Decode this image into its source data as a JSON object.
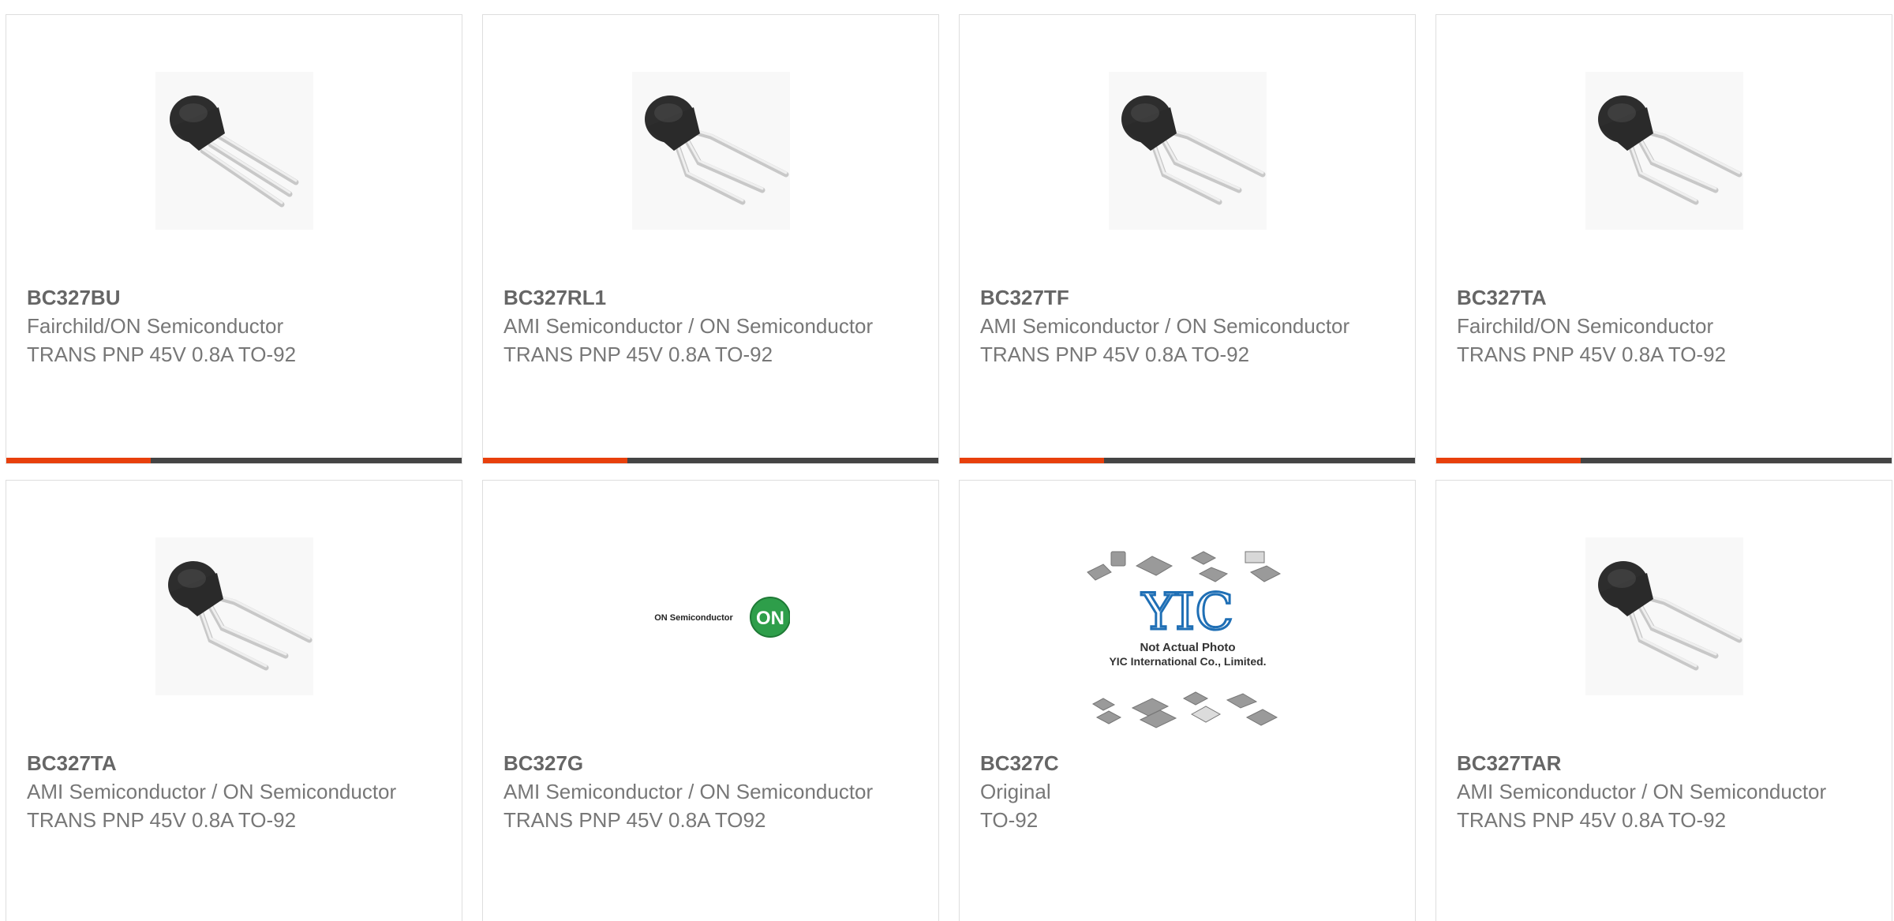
{
  "colors": {
    "accent": "#e8400c",
    "bar": "#444444",
    "on_logo_green": "#2e9e4a",
    "yic_blue": "#1f6fb5"
  },
  "products": [
    {
      "part": "BC327BU",
      "manufacturer": "Fairchild/ON Semiconductor",
      "description": "TRANS PNP 45V 0.8A TO-92",
      "image_icon": "to92-transistor-icon"
    },
    {
      "part": "BC327RL1",
      "manufacturer": "AMI Semiconductor / ON Semiconductor",
      "description": "TRANS PNP 45V 0.8A TO-92",
      "image_icon": "to92-transistor-bent-leads-icon"
    },
    {
      "part": "BC327TF",
      "manufacturer": "AMI Semiconductor / ON Semiconductor",
      "description": "TRANS PNP 45V 0.8A TO-92",
      "image_icon": "to92-transistor-bent-leads-icon"
    },
    {
      "part": "BC327TA",
      "manufacturer": "Fairchild/ON Semiconductor",
      "description": "TRANS PNP 45V 0.8A TO-92",
      "image_icon": "to92-transistor-bent-leads-icon"
    },
    {
      "part": "BC327TA",
      "manufacturer": "AMI Semiconductor / ON Semiconductor",
      "description": "TRANS PNP 45V 0.8A TO-92",
      "image_icon": "to92-transistor-bent-leads-icon"
    },
    {
      "part": "BC327G",
      "manufacturer": "AMI Semiconductor / ON Semiconductor",
      "description": "TRANS PNP 45V 0.8A TO92",
      "image_icon": "on-semiconductor-logo",
      "logo_text": "ON Semiconductor",
      "logo_badge": "ON"
    },
    {
      "part": "BC327C",
      "manufacturer": "Original",
      "description": "TO-92",
      "image_icon": "yic-placeholder-icon",
      "logo_mark": "YIC",
      "placeholder_line1": "Not Actual Photo",
      "placeholder_line2": "YIC International Co., Limited."
    },
    {
      "part": "BC327TAR",
      "manufacturer": "AMI Semiconductor / ON Semiconductor",
      "description": "TRANS PNP 45V 0.8A TO-92",
      "image_icon": "to92-transistor-bent-leads-icon"
    }
  ]
}
